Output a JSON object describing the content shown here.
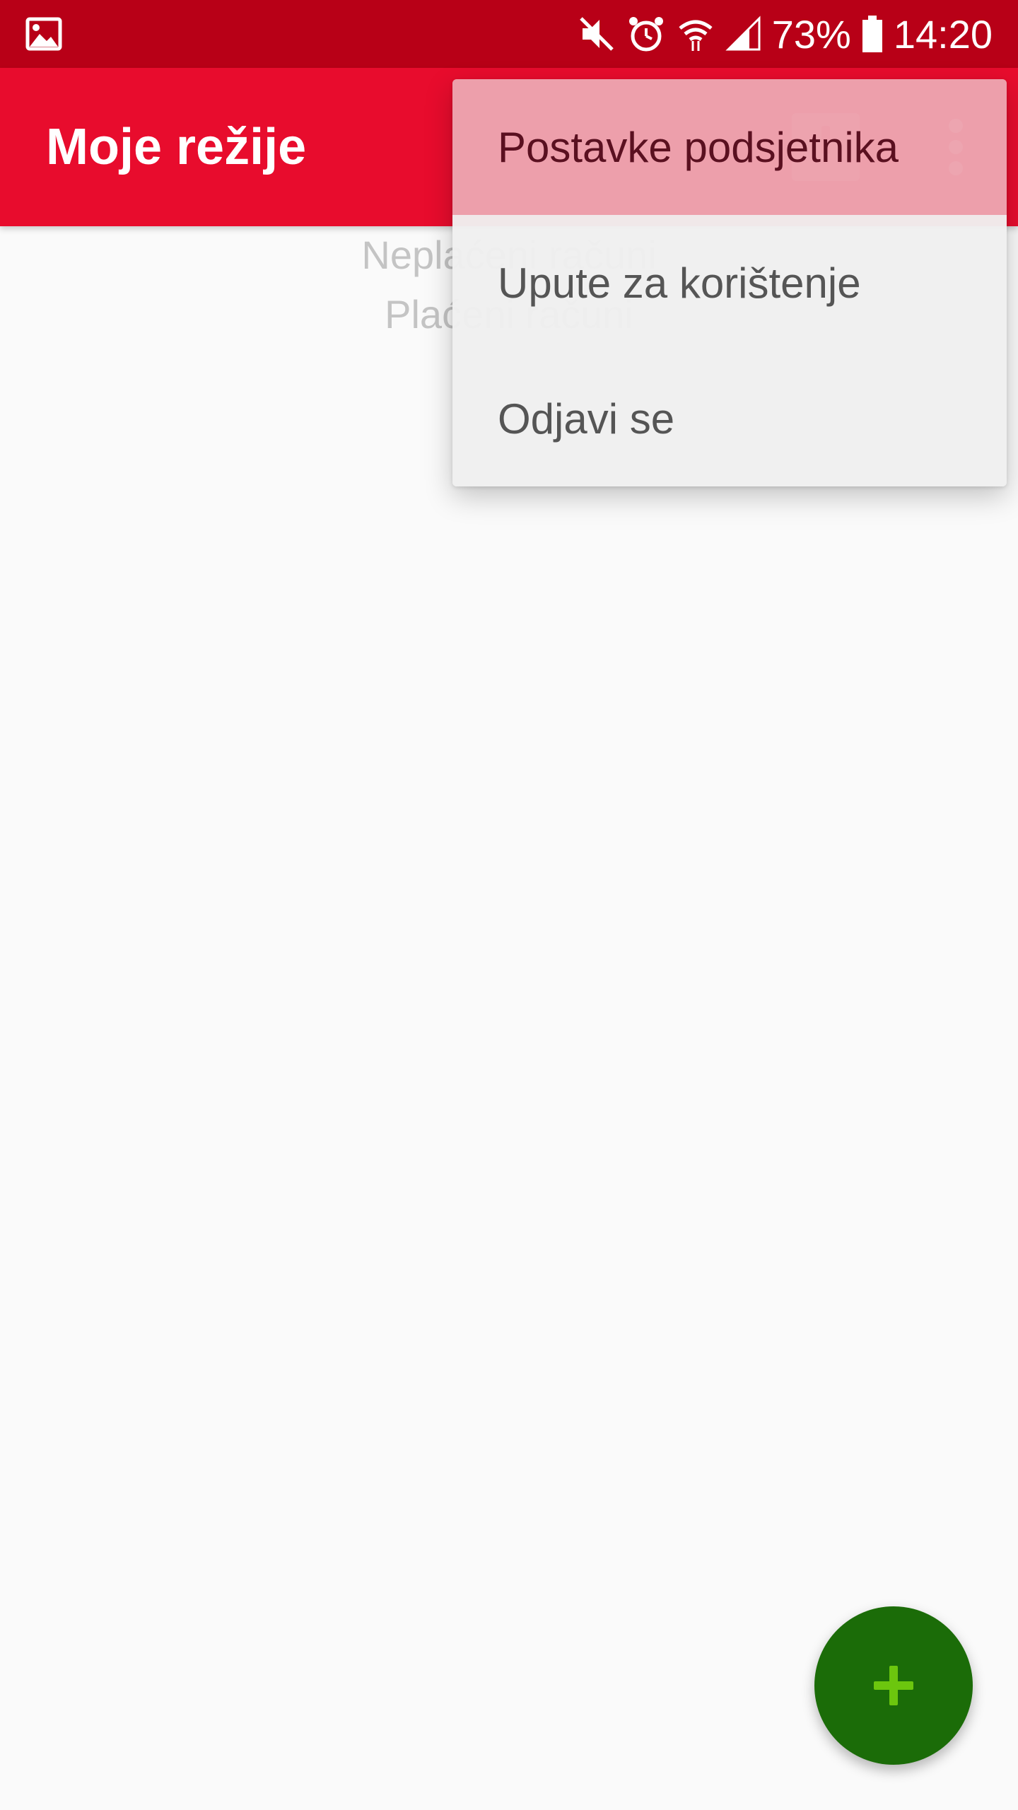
{
  "status_bar": {
    "battery": "73%",
    "time": "14:20",
    "icons": [
      "gallery-icon",
      "mute-icon",
      "alarm-icon",
      "wifi-icon",
      "signal-icon",
      "battery-icon"
    ]
  },
  "app_bar": {
    "title": "Moje režije",
    "background": "#e80c2d",
    "status_background": "#b80017",
    "actions": [
      "notification-icon",
      "overflow-menu-icon"
    ]
  },
  "segments": {
    "unpaid": "Neplaćeni računi",
    "paid": "Plaćeni računi"
  },
  "overflow_menu": {
    "items": [
      {
        "label": "Postavke podsjetnika",
        "highlighted": true
      },
      {
        "label": "Upute za korištenje"
      },
      {
        "label": "Odjavi se"
      }
    ]
  },
  "fab": {
    "icon": "plus-icon",
    "color": "#1b6c08",
    "icon_color": "#6cc60e"
  }
}
